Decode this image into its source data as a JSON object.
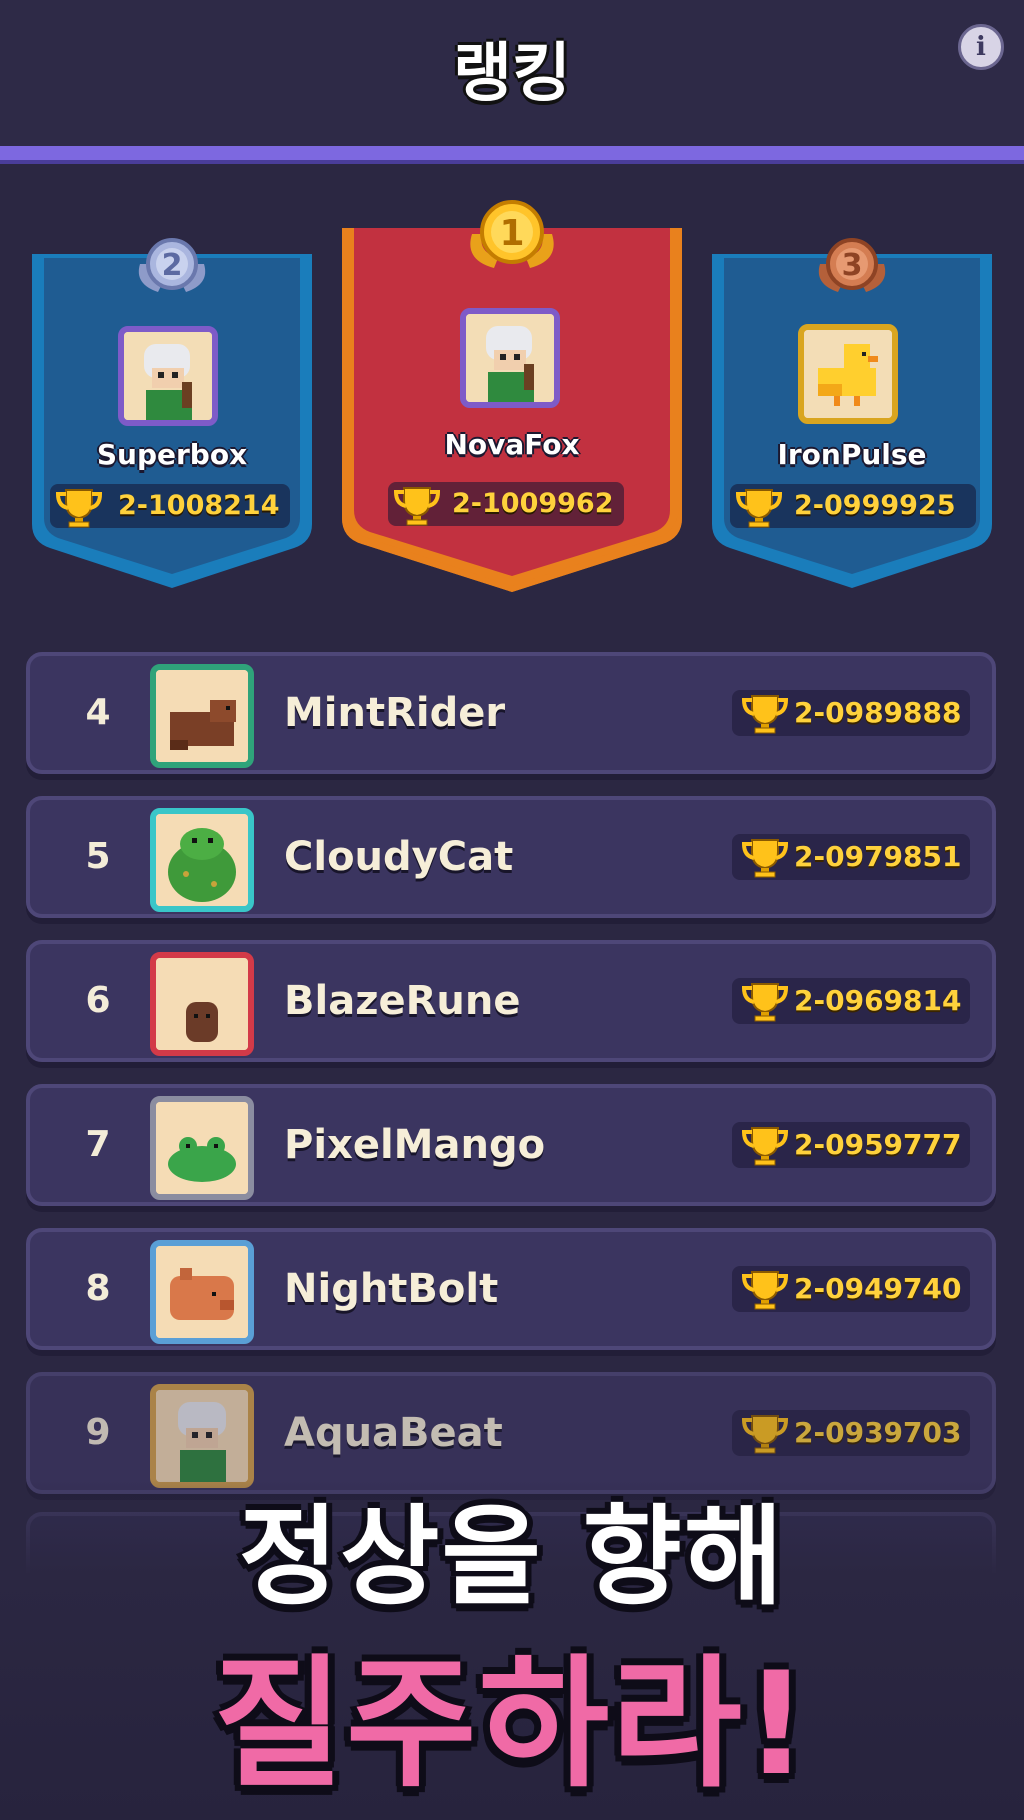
{
  "header": {
    "title": "랭킹",
    "info_icon": "i"
  },
  "podium": [
    {
      "rank": "2",
      "name": "Superbox",
      "score": "2-1008214",
      "medal": "silver",
      "color": "#1f5c92"
    },
    {
      "rank": "1",
      "name": "NovaFox",
      "score": "2-1009962",
      "medal": "gold",
      "color": "#c23140"
    },
    {
      "rank": "3",
      "name": "IronPulse",
      "score": "2-0999925",
      "medal": "bronze",
      "color": "#1f5c92"
    }
  ],
  "rows": [
    {
      "rank": "4",
      "name": "MintRider",
      "score": "2-0989888",
      "frame": "#2fa37a"
    },
    {
      "rank": "5",
      "name": "CloudyCat",
      "score": "2-0979851",
      "frame": "#39c6c8"
    },
    {
      "rank": "6",
      "name": "BlazeRune",
      "score": "2-0969814",
      "frame": "#d33a48"
    },
    {
      "rank": "7",
      "name": "PixelMango",
      "score": "2-0959777",
      "frame": "#8b8da0"
    },
    {
      "rank": "8",
      "name": "NightBolt",
      "score": "2-0949740",
      "frame": "#5a9fd6"
    },
    {
      "rank": "9",
      "name": "AquaBeat",
      "score": "2-0939703",
      "frame": "#d5a24a"
    }
  ],
  "slogan": {
    "line1": "정상을 향해",
    "line2": "질주하라!"
  },
  "colors": {
    "accent": "#7d68e0",
    "gold_text": "#ffd23c",
    "pink": "#f06aa6"
  }
}
